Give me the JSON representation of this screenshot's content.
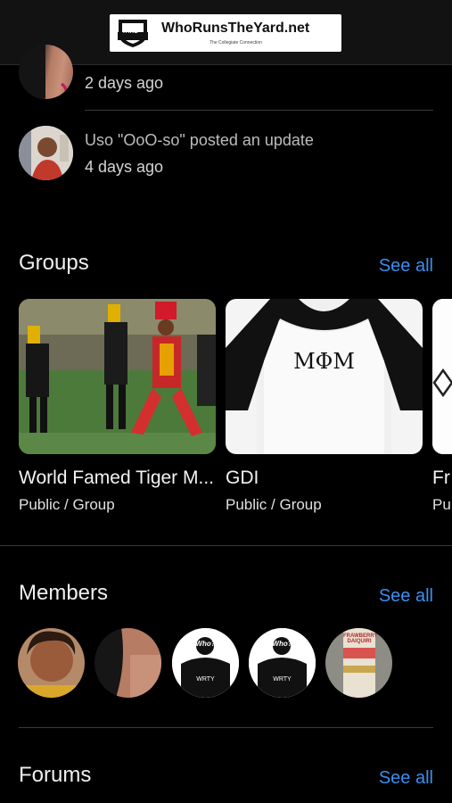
{
  "header": {
    "logo_text": "WhoRunsTheYard.net",
    "logo_subtitle": "The Collegiate Connection",
    "logo_badge_text": "YARD"
  },
  "activity": [
    {
      "title": "",
      "time": "2 days ago"
    },
    {
      "title": "Uso \"OoO-so\" posted an update",
      "time": "4 days ago"
    }
  ],
  "groups": {
    "title": "Groups",
    "see_all": "See all",
    "items": [
      {
        "name": "World Famed Tiger M...",
        "meta": "Public / Group"
      },
      {
        "name": "GDI",
        "meta": "Public / Group",
        "image_text": "MΦM"
      },
      {
        "name": "Fr",
        "meta": "Pu"
      }
    ]
  },
  "members": {
    "title": "Members",
    "see_all": "See all",
    "shirt_badge": "Who?",
    "shirt_text": "WRTY",
    "can_text": "FRAWBERRY DAIQUIRI"
  },
  "forums": {
    "title": "Forums",
    "see_all": "See all"
  },
  "colors": {
    "background": "#000000",
    "accent": "#3b8ff0",
    "divider": "#3a3a3a"
  }
}
